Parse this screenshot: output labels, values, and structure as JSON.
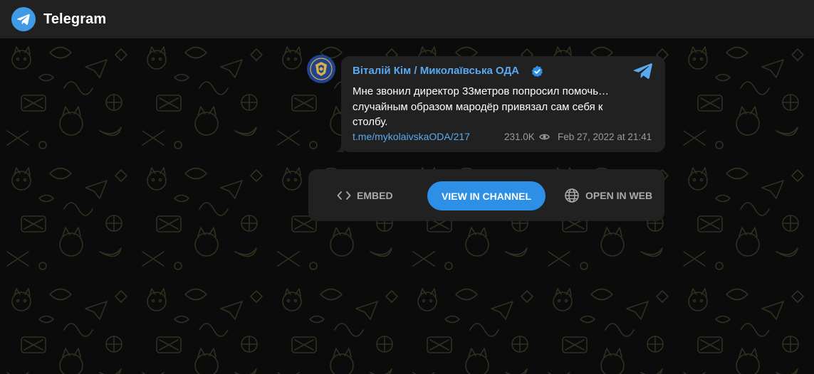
{
  "header": {
    "brand": "Telegram",
    "logo_icon": "telegram-logo-icon",
    "accent": "#3f9be6"
  },
  "post": {
    "channel_name": "Віталій Кім / Миколаївська ОДА",
    "verified_icon": "verified-badge-icon",
    "corner_icon": "telegram-plane-icon",
    "message_lines": [
      "Мне звонил директор 33метров попросил помочь…",
      "случайным образом мародёр привязал сам себя к",
      "столбу."
    ],
    "link": "t.me/mykolaivskaODA/217",
    "views": "231.0K",
    "views_icon": "eye-icon",
    "datetime": "Feb 27, 2022 at 21:41",
    "link_color": "#5aa9f0"
  },
  "actions": {
    "embed": {
      "label": "EMBED",
      "icon": "code-brackets-icon"
    },
    "view_in_channel": {
      "label": "VIEW IN CHANNEL",
      "color": "#2d8fe5"
    },
    "open_in_web": {
      "label": "OPEN IN WEB",
      "icon": "globe-icon"
    }
  }
}
